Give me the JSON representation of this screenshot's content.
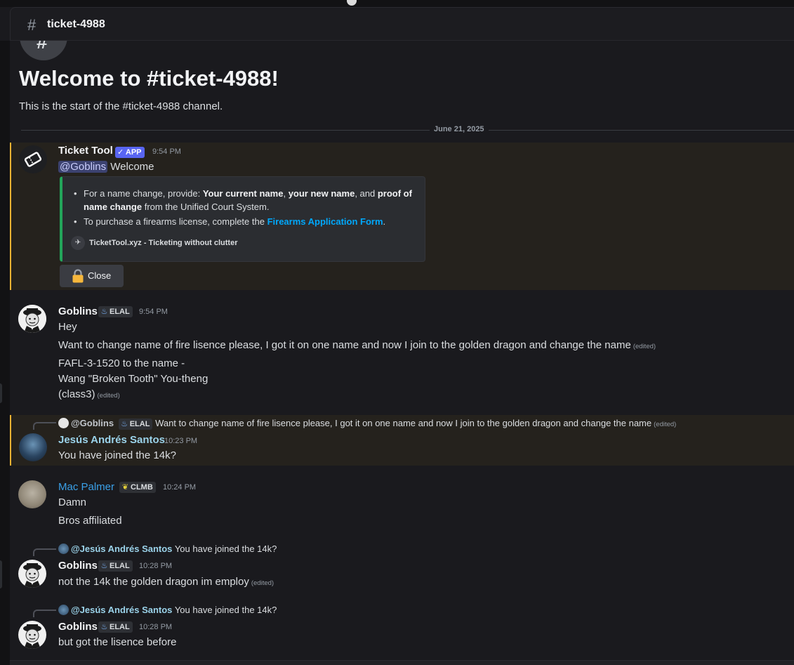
{
  "header": {
    "hash": "#",
    "channel": "ticket-4988"
  },
  "intro": {
    "icon": "#",
    "title": "Welcome to #ticket-4988!",
    "subtitle": "This is the start of the #ticket-4988 channel."
  },
  "date_divider": "June 21, 2025",
  "messages": [
    {
      "author": "Ticket Tool",
      "badge": "APP",
      "time": "9:54 PM",
      "mention": "@Goblins",
      "text": "Welcome",
      "embed": {
        "item1_a": "For a name change, provide: ",
        "item1_b": "Your current name",
        "item1_c": ", ",
        "item1_d": "your new name",
        "item1_e": ", and ",
        "item1_f": "proof of name change",
        "item1_g": " from the Unified Court System.",
        "item2_a": "To purchase a firearms license, complete the ",
        "item2_link": "Firearms Application Form",
        "item2_b": ".",
        "footer": "TicketTool.xyz - Ticketing without clutter"
      },
      "button": "Close"
    },
    {
      "author": "Goblins",
      "tag": "ELAL",
      "time": "9:54 PM",
      "lines": [
        "Hey",
        "Want to change name of fire lisence please, I got it on one name and now I join to the golden dragon and change the name",
        "FAFL-3-1520 to the name -",
        "Wang \"Broken Tooth\" You-theng",
        "(class3)"
      ],
      "edited": "(edited)"
    },
    {
      "reply_author": "@Goblins",
      "reply_tag": "ELAL",
      "reply_text": "Want to change name of fire lisence please, I got it on one name and now I join to the golden dragon and change the name",
      "reply_edited": "(edited)",
      "author": "Jesús Andrés Santos",
      "time": "10:23 PM",
      "text": "You have joined the 14k?"
    },
    {
      "author": "Mac Palmer",
      "tag": "CLMB",
      "time": "10:24 PM",
      "lines": [
        "Damn",
        "Bros affiliated"
      ]
    },
    {
      "reply_author": "@Jesús Andrés Santos",
      "reply_text": "You have joined the 14k?",
      "author": "Goblins",
      "tag": "ELAL",
      "time": "10:28 PM",
      "text": "not the 14k the golden dragon im employ",
      "edited": "(edited)"
    },
    {
      "reply_author": "@Jesús Andrés Santos",
      "reply_text": "You have joined the 14k?",
      "author": "Goblins",
      "tag": "ELAL",
      "time": "10:28 PM",
      "text": "but got the lisence before"
    }
  ],
  "colors": {
    "background": "#1a1a1e",
    "highlight_bar": "#f0b232",
    "embed_bar": "#23a55a",
    "app_badge": "#5865f2",
    "link": "#00a8fc",
    "jesus_name": "#9bd3ea",
    "mac_name": "#3aa0e8"
  },
  "icons": {
    "channel": "hash-icon",
    "ticket_tool_avatar": "ticket-icon",
    "verified": "check-icon",
    "elal_tag": "flame-icon",
    "clmb_tag": "leaf-icon",
    "close_button": "lock-icon"
  }
}
